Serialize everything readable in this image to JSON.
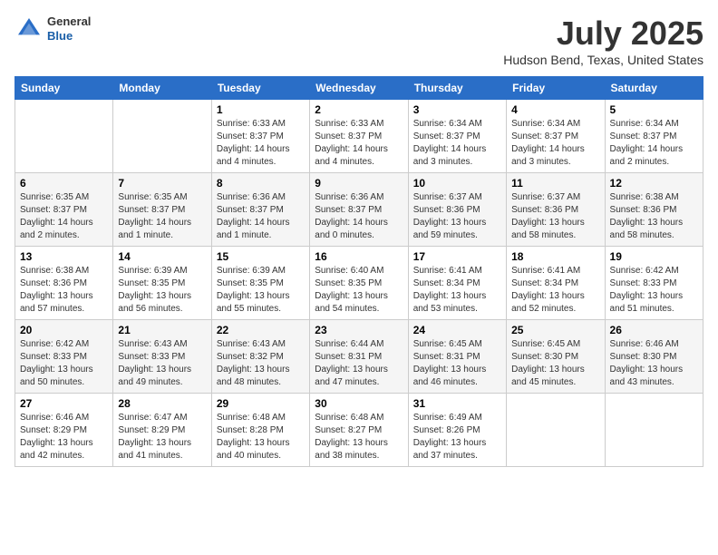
{
  "header": {
    "logo": {
      "general": "General",
      "blue": "Blue"
    },
    "title": "July 2025",
    "location": "Hudson Bend, Texas, United States"
  },
  "calendar": {
    "days_of_week": [
      "Sunday",
      "Monday",
      "Tuesday",
      "Wednesday",
      "Thursday",
      "Friday",
      "Saturday"
    ],
    "weeks": [
      [
        {
          "day": "",
          "info": ""
        },
        {
          "day": "",
          "info": ""
        },
        {
          "day": "1",
          "info": "Sunrise: 6:33 AM\nSunset: 8:37 PM\nDaylight: 14 hours and 4 minutes."
        },
        {
          "day": "2",
          "info": "Sunrise: 6:33 AM\nSunset: 8:37 PM\nDaylight: 14 hours and 4 minutes."
        },
        {
          "day": "3",
          "info": "Sunrise: 6:34 AM\nSunset: 8:37 PM\nDaylight: 14 hours and 3 minutes."
        },
        {
          "day": "4",
          "info": "Sunrise: 6:34 AM\nSunset: 8:37 PM\nDaylight: 14 hours and 3 minutes."
        },
        {
          "day": "5",
          "info": "Sunrise: 6:34 AM\nSunset: 8:37 PM\nDaylight: 14 hours and 2 minutes."
        }
      ],
      [
        {
          "day": "6",
          "info": "Sunrise: 6:35 AM\nSunset: 8:37 PM\nDaylight: 14 hours and 2 minutes."
        },
        {
          "day": "7",
          "info": "Sunrise: 6:35 AM\nSunset: 8:37 PM\nDaylight: 14 hours and 1 minute."
        },
        {
          "day": "8",
          "info": "Sunrise: 6:36 AM\nSunset: 8:37 PM\nDaylight: 14 hours and 1 minute."
        },
        {
          "day": "9",
          "info": "Sunrise: 6:36 AM\nSunset: 8:37 PM\nDaylight: 14 hours and 0 minutes."
        },
        {
          "day": "10",
          "info": "Sunrise: 6:37 AM\nSunset: 8:36 PM\nDaylight: 13 hours and 59 minutes."
        },
        {
          "day": "11",
          "info": "Sunrise: 6:37 AM\nSunset: 8:36 PM\nDaylight: 13 hours and 58 minutes."
        },
        {
          "day": "12",
          "info": "Sunrise: 6:38 AM\nSunset: 8:36 PM\nDaylight: 13 hours and 58 minutes."
        }
      ],
      [
        {
          "day": "13",
          "info": "Sunrise: 6:38 AM\nSunset: 8:36 PM\nDaylight: 13 hours and 57 minutes."
        },
        {
          "day": "14",
          "info": "Sunrise: 6:39 AM\nSunset: 8:35 PM\nDaylight: 13 hours and 56 minutes."
        },
        {
          "day": "15",
          "info": "Sunrise: 6:39 AM\nSunset: 8:35 PM\nDaylight: 13 hours and 55 minutes."
        },
        {
          "day": "16",
          "info": "Sunrise: 6:40 AM\nSunset: 8:35 PM\nDaylight: 13 hours and 54 minutes."
        },
        {
          "day": "17",
          "info": "Sunrise: 6:41 AM\nSunset: 8:34 PM\nDaylight: 13 hours and 53 minutes."
        },
        {
          "day": "18",
          "info": "Sunrise: 6:41 AM\nSunset: 8:34 PM\nDaylight: 13 hours and 52 minutes."
        },
        {
          "day": "19",
          "info": "Sunrise: 6:42 AM\nSunset: 8:33 PM\nDaylight: 13 hours and 51 minutes."
        }
      ],
      [
        {
          "day": "20",
          "info": "Sunrise: 6:42 AM\nSunset: 8:33 PM\nDaylight: 13 hours and 50 minutes."
        },
        {
          "day": "21",
          "info": "Sunrise: 6:43 AM\nSunset: 8:33 PM\nDaylight: 13 hours and 49 minutes."
        },
        {
          "day": "22",
          "info": "Sunrise: 6:43 AM\nSunset: 8:32 PM\nDaylight: 13 hours and 48 minutes."
        },
        {
          "day": "23",
          "info": "Sunrise: 6:44 AM\nSunset: 8:31 PM\nDaylight: 13 hours and 47 minutes."
        },
        {
          "day": "24",
          "info": "Sunrise: 6:45 AM\nSunset: 8:31 PM\nDaylight: 13 hours and 46 minutes."
        },
        {
          "day": "25",
          "info": "Sunrise: 6:45 AM\nSunset: 8:30 PM\nDaylight: 13 hours and 45 minutes."
        },
        {
          "day": "26",
          "info": "Sunrise: 6:46 AM\nSunset: 8:30 PM\nDaylight: 13 hours and 43 minutes."
        }
      ],
      [
        {
          "day": "27",
          "info": "Sunrise: 6:46 AM\nSunset: 8:29 PM\nDaylight: 13 hours and 42 minutes."
        },
        {
          "day": "28",
          "info": "Sunrise: 6:47 AM\nSunset: 8:29 PM\nDaylight: 13 hours and 41 minutes."
        },
        {
          "day": "29",
          "info": "Sunrise: 6:48 AM\nSunset: 8:28 PM\nDaylight: 13 hours and 40 minutes."
        },
        {
          "day": "30",
          "info": "Sunrise: 6:48 AM\nSunset: 8:27 PM\nDaylight: 13 hours and 38 minutes."
        },
        {
          "day": "31",
          "info": "Sunrise: 6:49 AM\nSunset: 8:26 PM\nDaylight: 13 hours and 37 minutes."
        },
        {
          "day": "",
          "info": ""
        },
        {
          "day": "",
          "info": ""
        }
      ]
    ]
  }
}
